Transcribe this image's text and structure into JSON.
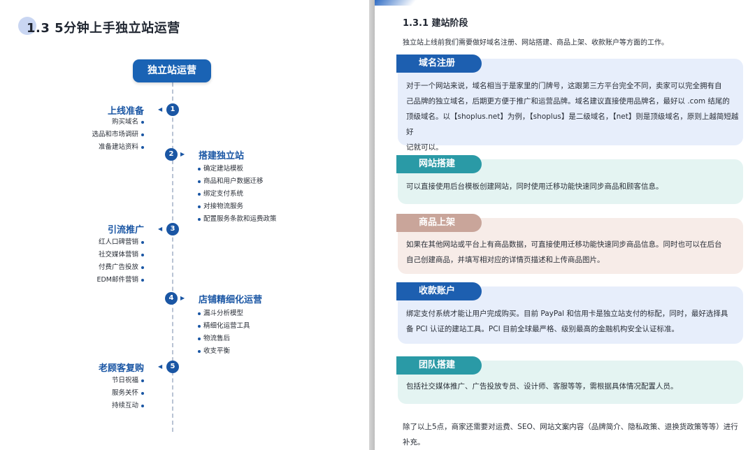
{
  "left_page": {
    "section_title": "1.3 5分钟上手独立站运营",
    "root_label": "独立站运营",
    "stages": [
      {
        "num": "1",
        "title": "上线准备",
        "items": [
          "购买域名",
          "选品和市场调研",
          "准备建站资料"
        ]
      },
      {
        "num": "2",
        "title": "搭建独立站",
        "items": [
          "确定建站模板",
          "商品和用户数据迁移",
          "绑定支付系统",
          "对接物流服务",
          "配置服务条款和运费政策"
        ]
      },
      {
        "num": "3",
        "title": "引流推广",
        "items": [
          "红人口碑营销",
          "社交媒体营销",
          "付费广告投放",
          "EDM邮件营销"
        ]
      },
      {
        "num": "4",
        "title": "店铺精细化运营",
        "items": [
          "漏斗分析模型",
          "精细化运营工具",
          "物流售后",
          "收支平衡"
        ]
      },
      {
        "num": "5",
        "title": "老顾客复购",
        "items": [
          "节日祝福",
          "服务关怀",
          "持续互动"
        ]
      }
    ]
  },
  "right_page": {
    "sub_title": "1.3.1 建站阶段",
    "intro": "独立站上线前我们需要做好域名注册、网站搭建、商品上架、收款账户等方面的工作。",
    "cards": [
      {
        "tag": "域名注册",
        "lines": [
          "对于一个网站来说，域名相当于是家里的门牌号，这跟第三方平台完全不同，卖家可以完全拥有自",
          "己品牌的独立域名，后期更方便于推广和运营品牌。域名建议直接使用品牌名，最好以 .com 结尾的",
          "顶级域名。以【shoplus.net】为例，【shoplus】是二级域名，【net】则是顶级域名，原则上越简短越好",
          "记就可以。"
        ]
      },
      {
        "tag": "网站搭建",
        "lines": [
          "可以直接使用后台模板创建网站，同时使用迁移功能快速同步商品和顾客信息。"
        ]
      },
      {
        "tag": "商品上架",
        "lines": [
          "如果在其他网站或平台上有商品数据，可直接使用迁移功能快速同步商品信息。同时也可以在后台",
          "自己创建商品，并填写相对应的详情页描述和上传商品图片。"
        ]
      },
      {
        "tag": "收款账户",
        "lines": [
          "绑定支付系统才能让用户完成购买。目前 PayPal 和信用卡是独立站支付的标配，同时，最好选择具",
          "备 PCI 认证的建站工具。PCI 目前全球最严格、级别最高的金融机构安全认证标准。"
        ]
      },
      {
        "tag": "团队搭建",
        "lines": [
          "包括社交媒体推广、广告投放专员、设计师、客服等等，需根据具体情况配置人员。"
        ]
      }
    ],
    "outro_lines": [
      "除了以上5点，商家还需要对运费、SEO、网站文案内容（品牌简介、隐私政策、退换货政策等等）进行",
      "补充。"
    ]
  },
  "colors": {
    "primary_blue": "#1a56a4",
    "tag_blue": "#1d5fb0",
    "tag_teal": "#2a9aa6",
    "tag_tan": "#c9a59a",
    "card_blue_bg": "#e7eefb",
    "card_teal_bg": "#e4f4f2",
    "card_tan_bg": "#f7ece8"
  }
}
